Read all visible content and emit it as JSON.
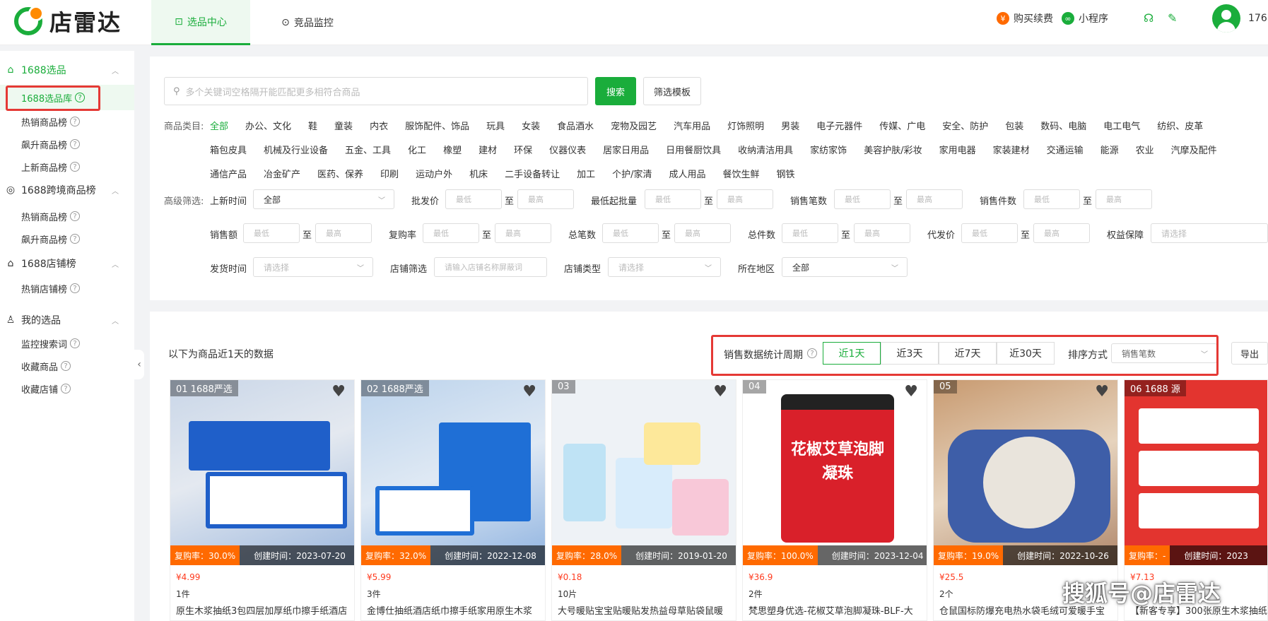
{
  "app": {
    "logo_text": "店雷达"
  },
  "header": {
    "tabs": [
      {
        "label": "选品中心",
        "active": true
      },
      {
        "label": "竞品监控",
        "active": false
      }
    ],
    "right": {
      "buy": "购买续费",
      "mini": "小程序",
      "user_id": "176"
    }
  },
  "sidebar": {
    "sections": [
      {
        "title": "1688选品",
        "items": [
          "1688选品库",
          "热销商品榜",
          "飙升商品榜",
          "上新商品榜"
        ]
      },
      {
        "title": "1688跨境商品榜",
        "items": [
          "热销商品榜",
          "飙升商品榜"
        ]
      },
      {
        "title": "1688店铺榜",
        "items": [
          "热销店铺榜"
        ]
      },
      {
        "title": "我的选品",
        "items": [
          "监控搜索词",
          "收藏商品",
          "收藏店铺"
        ]
      }
    ]
  },
  "search": {
    "placeholder": "多个关键词空格隔开能匹配更多相符合商品",
    "button": "搜索",
    "template": "筛选模板"
  },
  "categories": {
    "label": "商品类目:",
    "row1": [
      "全部",
      "办公、文化",
      "鞋",
      "童装",
      "内衣",
      "服饰配件、饰品",
      "玩具",
      "女装",
      "食品酒水",
      "宠物及园艺",
      "汽车用品",
      "灯饰照明",
      "男装",
      "电子元器件",
      "传媒、广电",
      "安全、防护",
      "包装",
      "数码、电脑",
      "电工电气",
      "纺织、皮革"
    ],
    "row2": [
      "箱包皮具",
      "机械及行业设备",
      "五金、工具",
      "化工",
      "橡塑",
      "建材",
      "环保",
      "仪器仪表",
      "居家日用品",
      "日用餐厨饮具",
      "收纳清洁用具",
      "家纺家饰",
      "美容护肤/彩妆",
      "家用电器",
      "家装建材",
      "交通运输",
      "能源",
      "农业",
      "汽摩及配件"
    ],
    "row3": [
      "通信产品",
      "冶金矿产",
      "医药、保养",
      "印刷",
      "运动户外",
      "机床",
      "二手设备转让",
      "加工",
      "个护/家清",
      "成人用品",
      "餐饮生鲜",
      "钢铁"
    ]
  },
  "filters": {
    "adv_label": "高级筛选:",
    "min": "最低",
    "max": "最高",
    "tilde": "至",
    "new_time": "上新时间",
    "all": "全部",
    "dist_price": "批发价",
    "min_batch": "最低起批量",
    "sales_cnt": "销售笔数",
    "sales_pcs": "销售件数",
    "sales_amt": "销售额",
    "repurchase": "复购率",
    "total_cnt": "总笔数",
    "total_pcs": "总件数",
    "proxy_price": "代发价",
    "rights": "权益保障",
    "please_select": "请选择",
    "ship_time": "发货时间",
    "shop_filter": "店铺筛选",
    "shop_ph": "请输入店铺名称屏蔽词",
    "shop_type": "店铺类型",
    "region": "所在地区"
  },
  "results": {
    "note": "以下为商品近1天的数据",
    "period_label": "销售数据统计周期",
    "periods": [
      "近1天",
      "近3天",
      "近7天",
      "近30天"
    ],
    "sort_label": "排序方式",
    "sort_value": "销售笔数",
    "export": "导出"
  },
  "products": [
    {
      "rank": "01",
      "tag": "1688严选",
      "rep": "复购率：30.0%",
      "ctime": "创建时间：2023-07-20",
      "price": "¥4.99",
      "qty": "1件",
      "title": "原生木浆抽纸3包四层加厚纸巾擦手纸酒店"
    },
    {
      "rank": "02",
      "tag": "1688严选",
      "rep": "复购率：32.0%",
      "ctime": "创建时间：2022-12-08",
      "price": "¥5.99",
      "qty": "3件",
      "title": "金博仕抽纸酒店纸巾擦手纸家用原生木浆"
    },
    {
      "rank": "03",
      "tag": "",
      "rep": "复购率：28.0%",
      "ctime": "创建时间：2019-01-20",
      "price": "¥0.18",
      "qty": "10片",
      "title": "大号暖贴宝宝贴暖贴发热益母草贴袋鼠暖"
    },
    {
      "rank": "04",
      "tag": "",
      "rep": "复购率：100.0%",
      "ctime": "创建时间：2023-12-04",
      "price": "¥36.9",
      "qty": "2件",
      "title": "梵思塑身优选-花椒艾草泡脚凝珠-BLF-大"
    },
    {
      "rank": "05",
      "tag": "",
      "rep": "复购率：19.0%",
      "ctime": "创建时间：2022-10-26",
      "price": "¥25.5",
      "qty": "2个",
      "title": "仓鼠国标防爆充电热水袋毛绒可爱暖手宝"
    },
    {
      "rank": "06",
      "tag": "1688 源",
      "rep": "复购率：-",
      "ctime": "创建时间：2023",
      "price": "¥7.13",
      "qty": "",
      "title": "【新客专享】300张原生木浆抽纸"
    }
  ],
  "product4_art": "花椒艾草泡脚凝珠",
  "watermark": "搜狐号@店雷达"
}
